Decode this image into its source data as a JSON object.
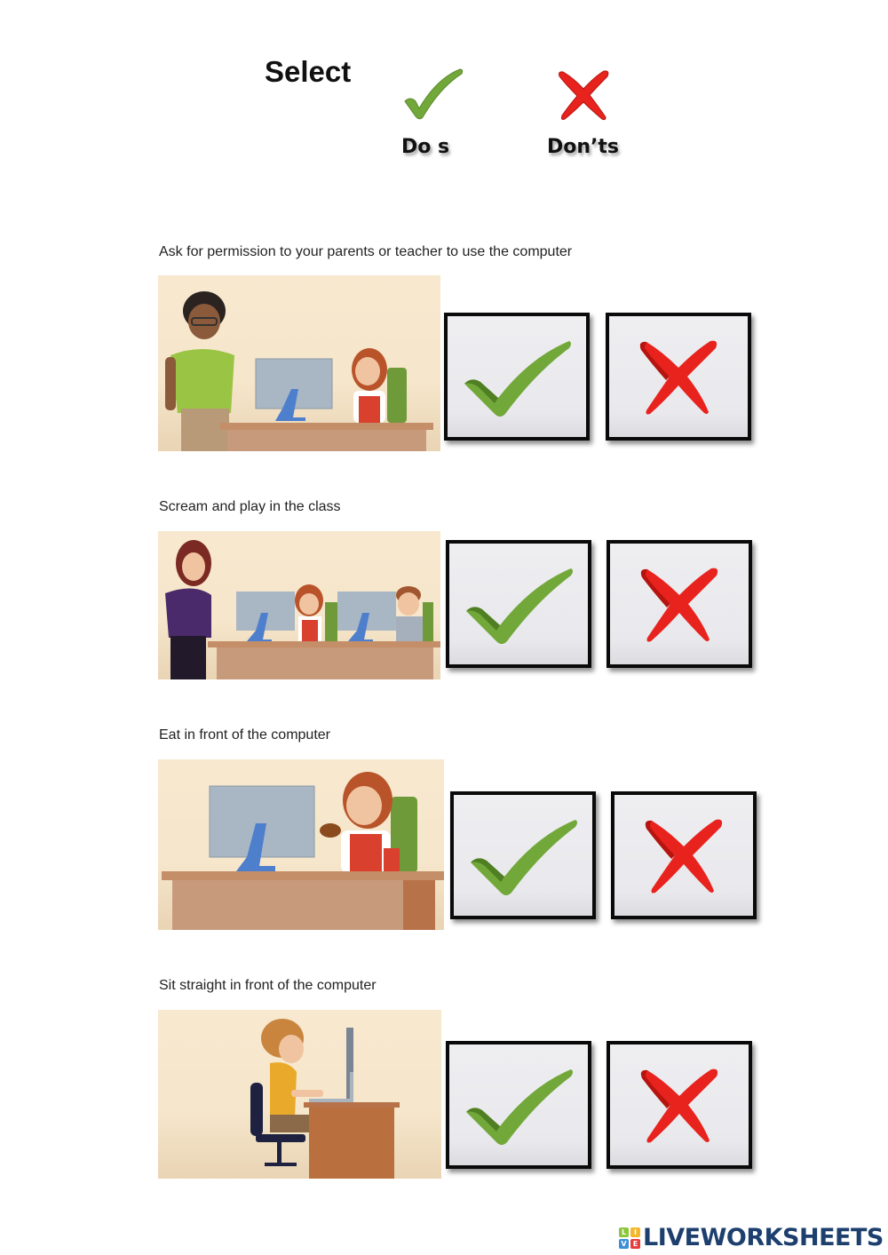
{
  "header": {
    "title": "Select",
    "legend": [
      {
        "icon": "check-icon",
        "label": "Do s",
        "color": "#72a83a"
      },
      {
        "icon": "cross-icon",
        "label": "Don’ts",
        "color": "#e8231e"
      }
    ]
  },
  "questions": [
    {
      "prompt": "Ask for permission to your parents or teacher to use the computer",
      "scene": "teacher-watching-girl-at-computer",
      "options": [
        {
          "icon": "check-icon",
          "label": "Do"
        },
        {
          "icon": "cross-icon",
          "label": "Don't"
        }
      ]
    },
    {
      "prompt": "Scream and play in the class",
      "scene": "teacher-watching-kids-playing",
      "options": [
        {
          "icon": "check-icon",
          "label": "Do"
        },
        {
          "icon": "cross-icon",
          "label": "Don't"
        }
      ]
    },
    {
      "prompt": "Eat in front of the computer",
      "scene": "girl-eating-burger-at-computer",
      "options": [
        {
          "icon": "check-icon",
          "label": "Do"
        },
        {
          "icon": "cross-icon",
          "label": "Don't"
        }
      ]
    },
    {
      "prompt": "Sit straight in front of the computer",
      "scene": "boy-sitting-straight-at-computer",
      "options": [
        {
          "icon": "check-icon",
          "label": "Do"
        },
        {
          "icon": "cross-icon",
          "label": "Don't"
        }
      ]
    }
  ],
  "footer": {
    "logo_blocks": [
      "L",
      "I",
      "V",
      "E"
    ],
    "logo_text": "LIVEWORKSHEETS",
    "brand_color": "#1d3f6e"
  },
  "colors": {
    "check": "#72a83a",
    "check_dark": "#4f7f22",
    "cross": "#e8231e",
    "cross_dark": "#b5140f",
    "box_border": "#0a0a0a",
    "box_fill": "#ececf0"
  }
}
